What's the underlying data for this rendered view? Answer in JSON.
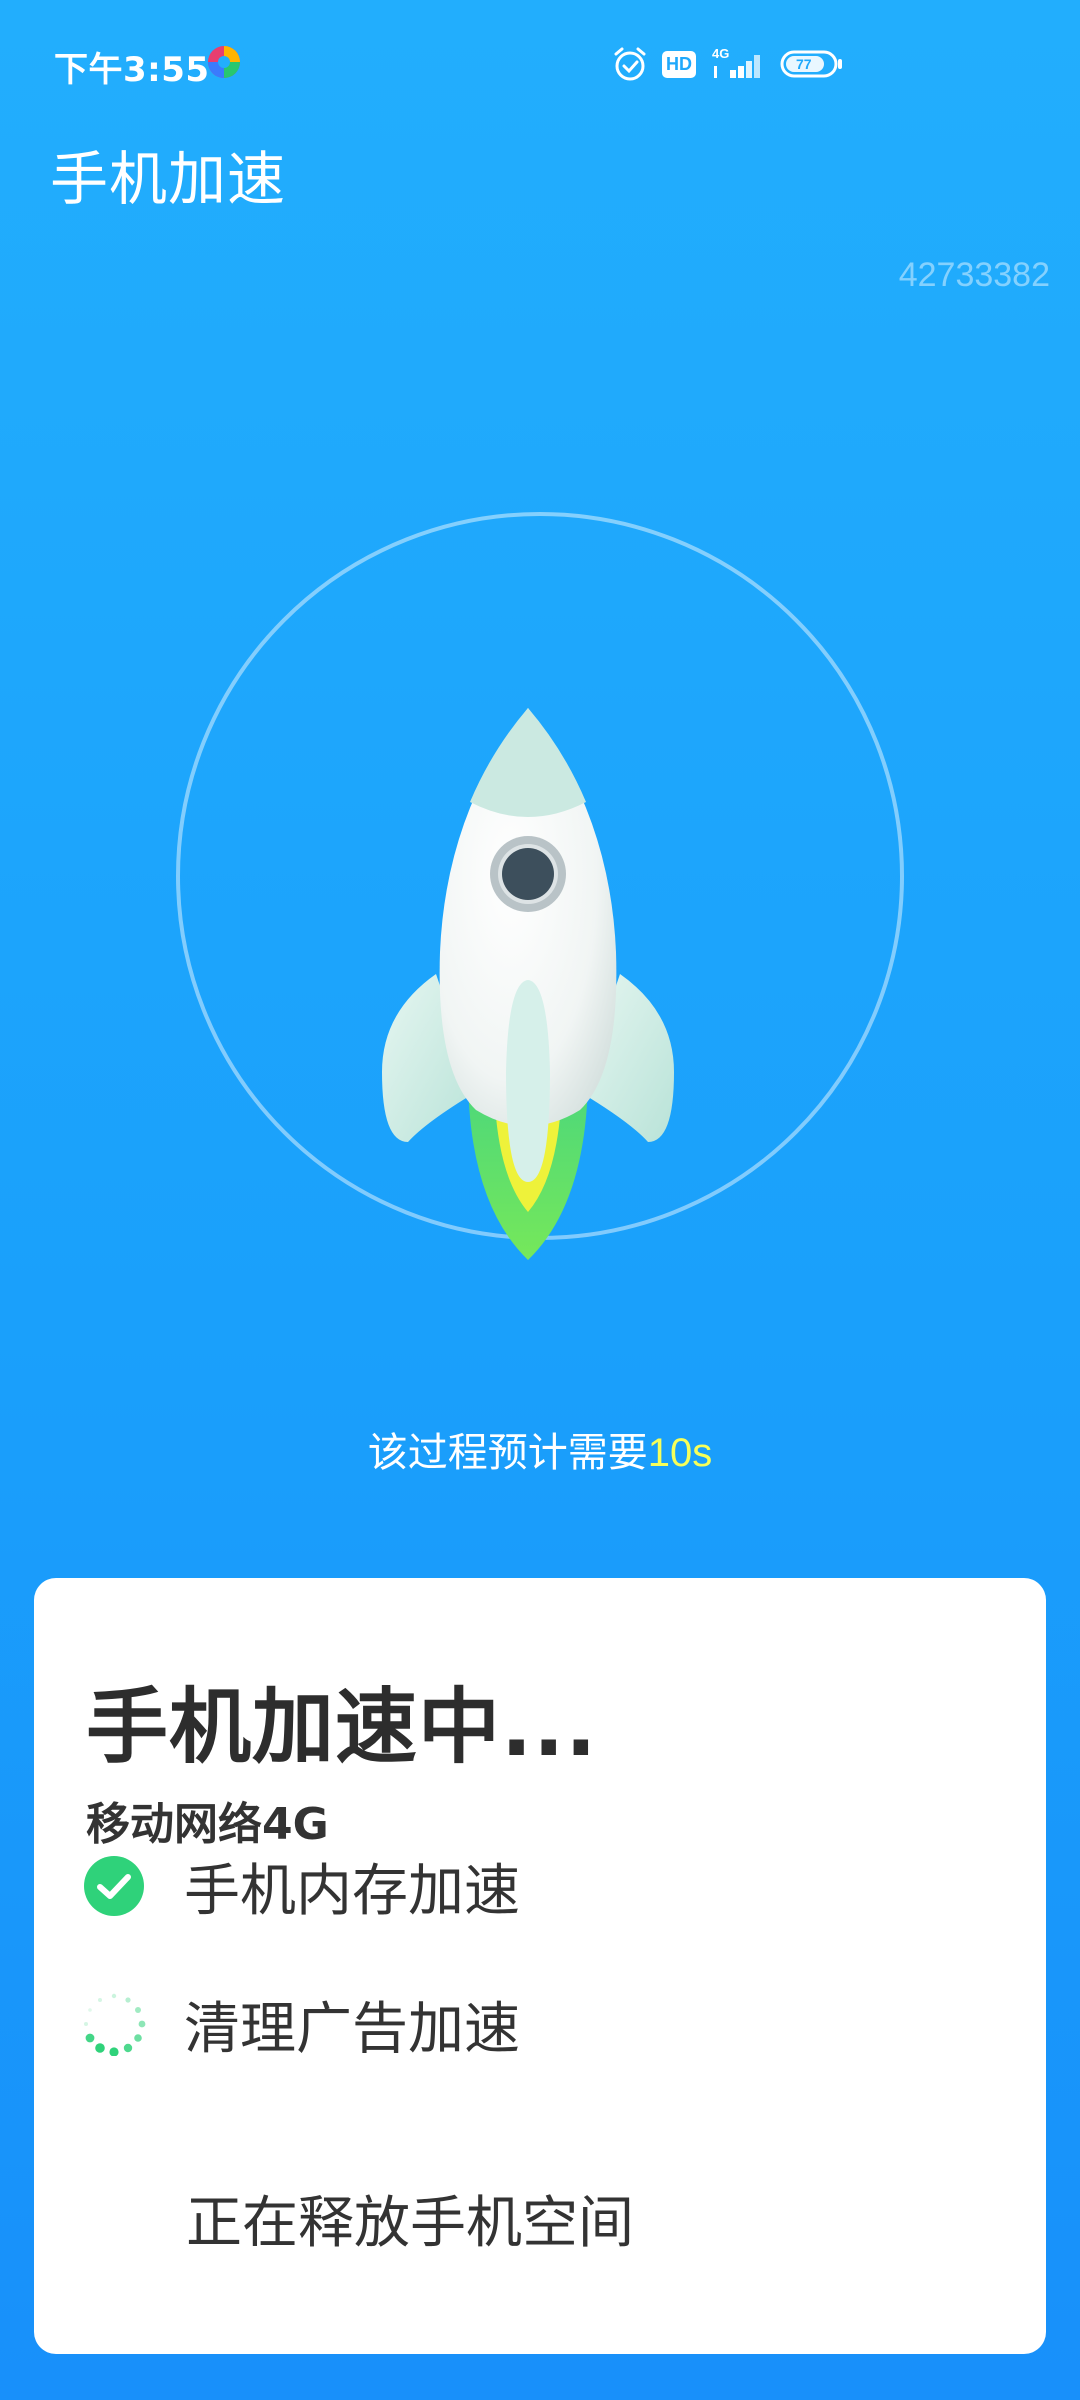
{
  "status_bar": {
    "time": "下午3:55",
    "network_label": "4G",
    "hd_label": "HD",
    "battery_level": "77"
  },
  "header": {
    "title": "手机加速"
  },
  "corner_id": "42733382",
  "hint": {
    "text": "该过程预计需要",
    "highlight": "10s"
  },
  "card": {
    "title": "手机加速中...",
    "subtitle": "移动网络4G",
    "tasks": [
      {
        "label": "手机内存加速",
        "state": "done"
      },
      {
        "label": "清理广告加速",
        "state": "in-progress"
      }
    ],
    "release_text": "正在释放手机空间"
  },
  "colors": {
    "background_top": "#22aefd",
    "background_bottom": "#1890fa",
    "highlight": "#f6ff5a",
    "check_green": "#2fd27a"
  }
}
